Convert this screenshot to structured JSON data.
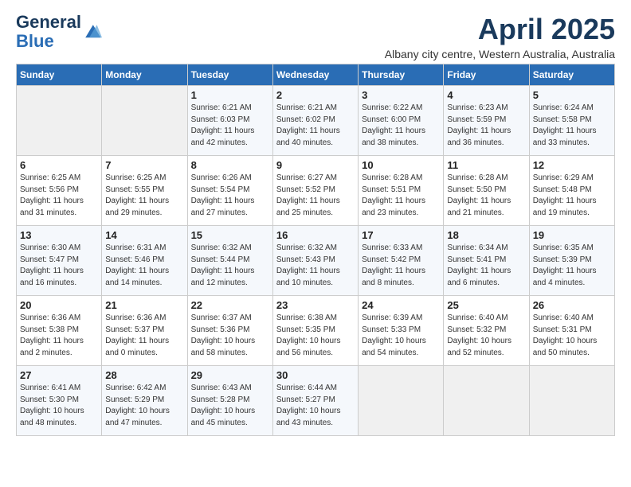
{
  "header": {
    "logo_line1": "General",
    "logo_line2": "Blue",
    "month": "April 2025",
    "subtitle": "Albany city centre, Western Australia, Australia"
  },
  "weekdays": [
    "Sunday",
    "Monday",
    "Tuesday",
    "Wednesday",
    "Thursday",
    "Friday",
    "Saturday"
  ],
  "weeks": [
    [
      {
        "day": "",
        "detail": ""
      },
      {
        "day": "",
        "detail": ""
      },
      {
        "day": "1",
        "detail": "Sunrise: 6:21 AM\nSunset: 6:03 PM\nDaylight: 11 hours\nand 42 minutes."
      },
      {
        "day": "2",
        "detail": "Sunrise: 6:21 AM\nSunset: 6:02 PM\nDaylight: 11 hours\nand 40 minutes."
      },
      {
        "day": "3",
        "detail": "Sunrise: 6:22 AM\nSunset: 6:00 PM\nDaylight: 11 hours\nand 38 minutes."
      },
      {
        "day": "4",
        "detail": "Sunrise: 6:23 AM\nSunset: 5:59 PM\nDaylight: 11 hours\nand 36 minutes."
      },
      {
        "day": "5",
        "detail": "Sunrise: 6:24 AM\nSunset: 5:58 PM\nDaylight: 11 hours\nand 33 minutes."
      }
    ],
    [
      {
        "day": "6",
        "detail": "Sunrise: 6:25 AM\nSunset: 5:56 PM\nDaylight: 11 hours\nand 31 minutes."
      },
      {
        "day": "7",
        "detail": "Sunrise: 6:25 AM\nSunset: 5:55 PM\nDaylight: 11 hours\nand 29 minutes."
      },
      {
        "day": "8",
        "detail": "Sunrise: 6:26 AM\nSunset: 5:54 PM\nDaylight: 11 hours\nand 27 minutes."
      },
      {
        "day": "9",
        "detail": "Sunrise: 6:27 AM\nSunset: 5:52 PM\nDaylight: 11 hours\nand 25 minutes."
      },
      {
        "day": "10",
        "detail": "Sunrise: 6:28 AM\nSunset: 5:51 PM\nDaylight: 11 hours\nand 23 minutes."
      },
      {
        "day": "11",
        "detail": "Sunrise: 6:28 AM\nSunset: 5:50 PM\nDaylight: 11 hours\nand 21 minutes."
      },
      {
        "day": "12",
        "detail": "Sunrise: 6:29 AM\nSunset: 5:48 PM\nDaylight: 11 hours\nand 19 minutes."
      }
    ],
    [
      {
        "day": "13",
        "detail": "Sunrise: 6:30 AM\nSunset: 5:47 PM\nDaylight: 11 hours\nand 16 minutes."
      },
      {
        "day": "14",
        "detail": "Sunrise: 6:31 AM\nSunset: 5:46 PM\nDaylight: 11 hours\nand 14 minutes."
      },
      {
        "day": "15",
        "detail": "Sunrise: 6:32 AM\nSunset: 5:44 PM\nDaylight: 11 hours\nand 12 minutes."
      },
      {
        "day": "16",
        "detail": "Sunrise: 6:32 AM\nSunset: 5:43 PM\nDaylight: 11 hours\nand 10 minutes."
      },
      {
        "day": "17",
        "detail": "Sunrise: 6:33 AM\nSunset: 5:42 PM\nDaylight: 11 hours\nand 8 minutes."
      },
      {
        "day": "18",
        "detail": "Sunrise: 6:34 AM\nSunset: 5:41 PM\nDaylight: 11 hours\nand 6 minutes."
      },
      {
        "day": "19",
        "detail": "Sunrise: 6:35 AM\nSunset: 5:39 PM\nDaylight: 11 hours\nand 4 minutes."
      }
    ],
    [
      {
        "day": "20",
        "detail": "Sunrise: 6:36 AM\nSunset: 5:38 PM\nDaylight: 11 hours\nand 2 minutes."
      },
      {
        "day": "21",
        "detail": "Sunrise: 6:36 AM\nSunset: 5:37 PM\nDaylight: 11 hours\nand 0 minutes."
      },
      {
        "day": "22",
        "detail": "Sunrise: 6:37 AM\nSunset: 5:36 PM\nDaylight: 10 hours\nand 58 minutes."
      },
      {
        "day": "23",
        "detail": "Sunrise: 6:38 AM\nSunset: 5:35 PM\nDaylight: 10 hours\nand 56 minutes."
      },
      {
        "day": "24",
        "detail": "Sunrise: 6:39 AM\nSunset: 5:33 PM\nDaylight: 10 hours\nand 54 minutes."
      },
      {
        "day": "25",
        "detail": "Sunrise: 6:40 AM\nSunset: 5:32 PM\nDaylight: 10 hours\nand 52 minutes."
      },
      {
        "day": "26",
        "detail": "Sunrise: 6:40 AM\nSunset: 5:31 PM\nDaylight: 10 hours\nand 50 minutes."
      }
    ],
    [
      {
        "day": "27",
        "detail": "Sunrise: 6:41 AM\nSunset: 5:30 PM\nDaylight: 10 hours\nand 48 minutes."
      },
      {
        "day": "28",
        "detail": "Sunrise: 6:42 AM\nSunset: 5:29 PM\nDaylight: 10 hours\nand 47 minutes."
      },
      {
        "day": "29",
        "detail": "Sunrise: 6:43 AM\nSunset: 5:28 PM\nDaylight: 10 hours\nand 45 minutes."
      },
      {
        "day": "30",
        "detail": "Sunrise: 6:44 AM\nSunset: 5:27 PM\nDaylight: 10 hours\nand 43 minutes."
      },
      {
        "day": "",
        "detail": ""
      },
      {
        "day": "",
        "detail": ""
      },
      {
        "day": "",
        "detail": ""
      }
    ]
  ]
}
